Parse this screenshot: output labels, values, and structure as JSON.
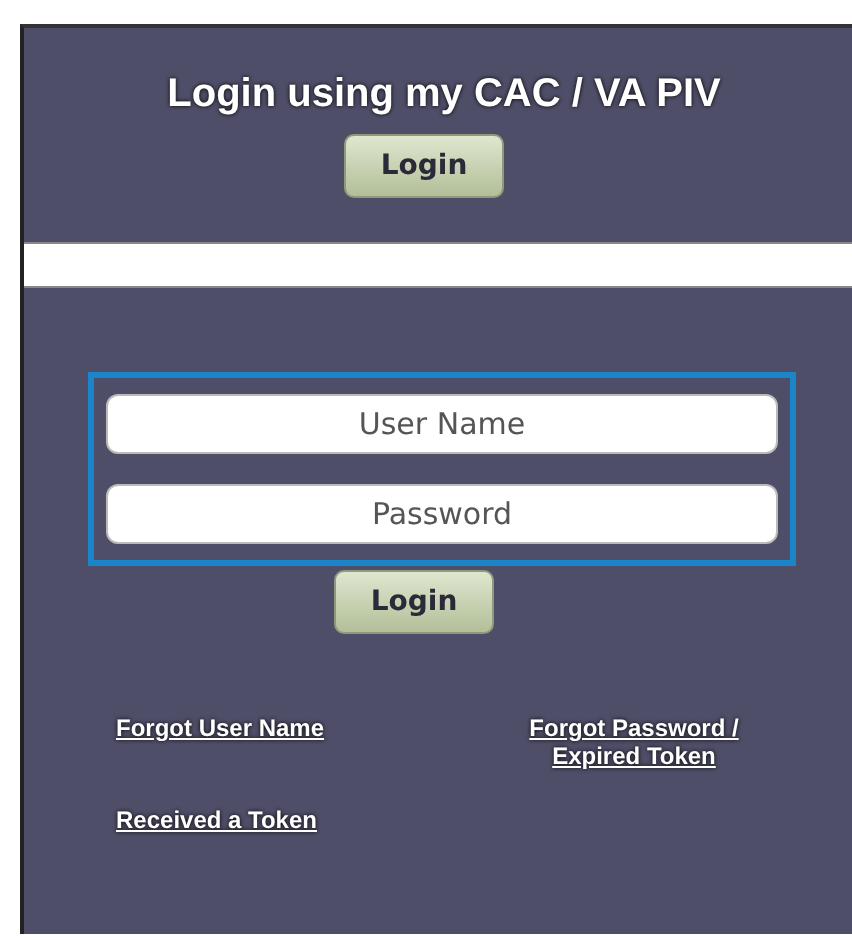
{
  "cac_section": {
    "title": "Login using my CAC / VA PIV",
    "button": "Login"
  },
  "credentials": {
    "fields": [
      {
        "placeholder": "User Name"
      },
      {
        "placeholder": "Password"
      }
    ],
    "button": "Login"
  },
  "links": [
    {
      "label": "Forgot User Name"
    },
    {
      "label": "Forgot Password / Expired Token"
    },
    {
      "label": "Received a Token"
    }
  ]
}
